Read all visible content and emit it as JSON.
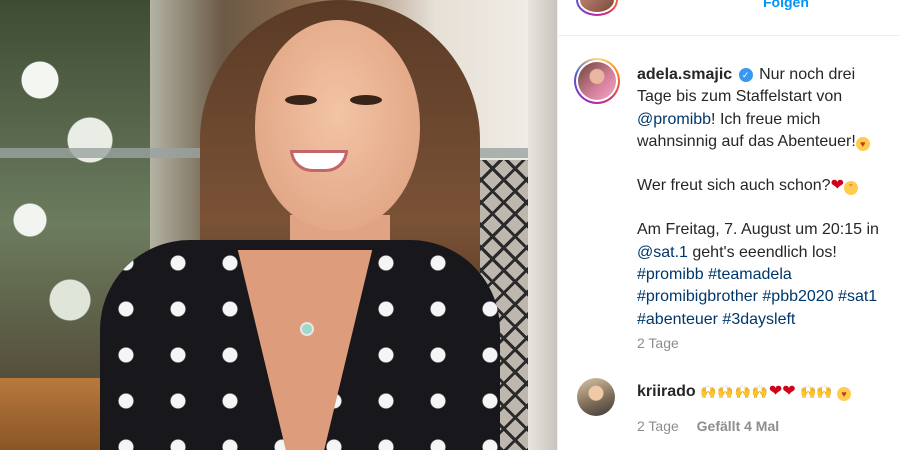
{
  "top_bar": {
    "follow_label": "Folgen"
  },
  "post": {
    "username": "adela.smajic",
    "caption_line1_text": " Nur noch drei Tage bis zum Staffelstart von ",
    "mention_promibb": "@promibb",
    "caption_line1_tail": "! Ich freue mich wahnsinnig auf das Abenteuer!",
    "caption_line2": "Wer freut sich auch schon?",
    "caption_line3": "Am Freitag, 7. August um 20:15 in ",
    "mention_sat1": "@sat.1",
    "caption_line3_tail": " geht's eeendlich los!",
    "hashtags": [
      "#promibb",
      "#teamadela",
      "#promibigbrother",
      "#pbb2020",
      "#sat1",
      "#abenteuer",
      "#3daysleft"
    ],
    "time_ago": "2 Tage"
  },
  "comment": {
    "username": "kriirado",
    "time_ago": "2 Tage",
    "likes": "Gefällt 4 Mal"
  },
  "icons": {
    "verified": "verified-badge-icon",
    "smile_emoji": "smiling-face-emoji",
    "heart_emoji": "red-heart-emoji",
    "hands_emoji": "raising-hands-emoji"
  },
  "colors": {
    "link": "#00376b",
    "secondary_text": "#8e8e8e",
    "follow_blue": "#0095f6"
  }
}
